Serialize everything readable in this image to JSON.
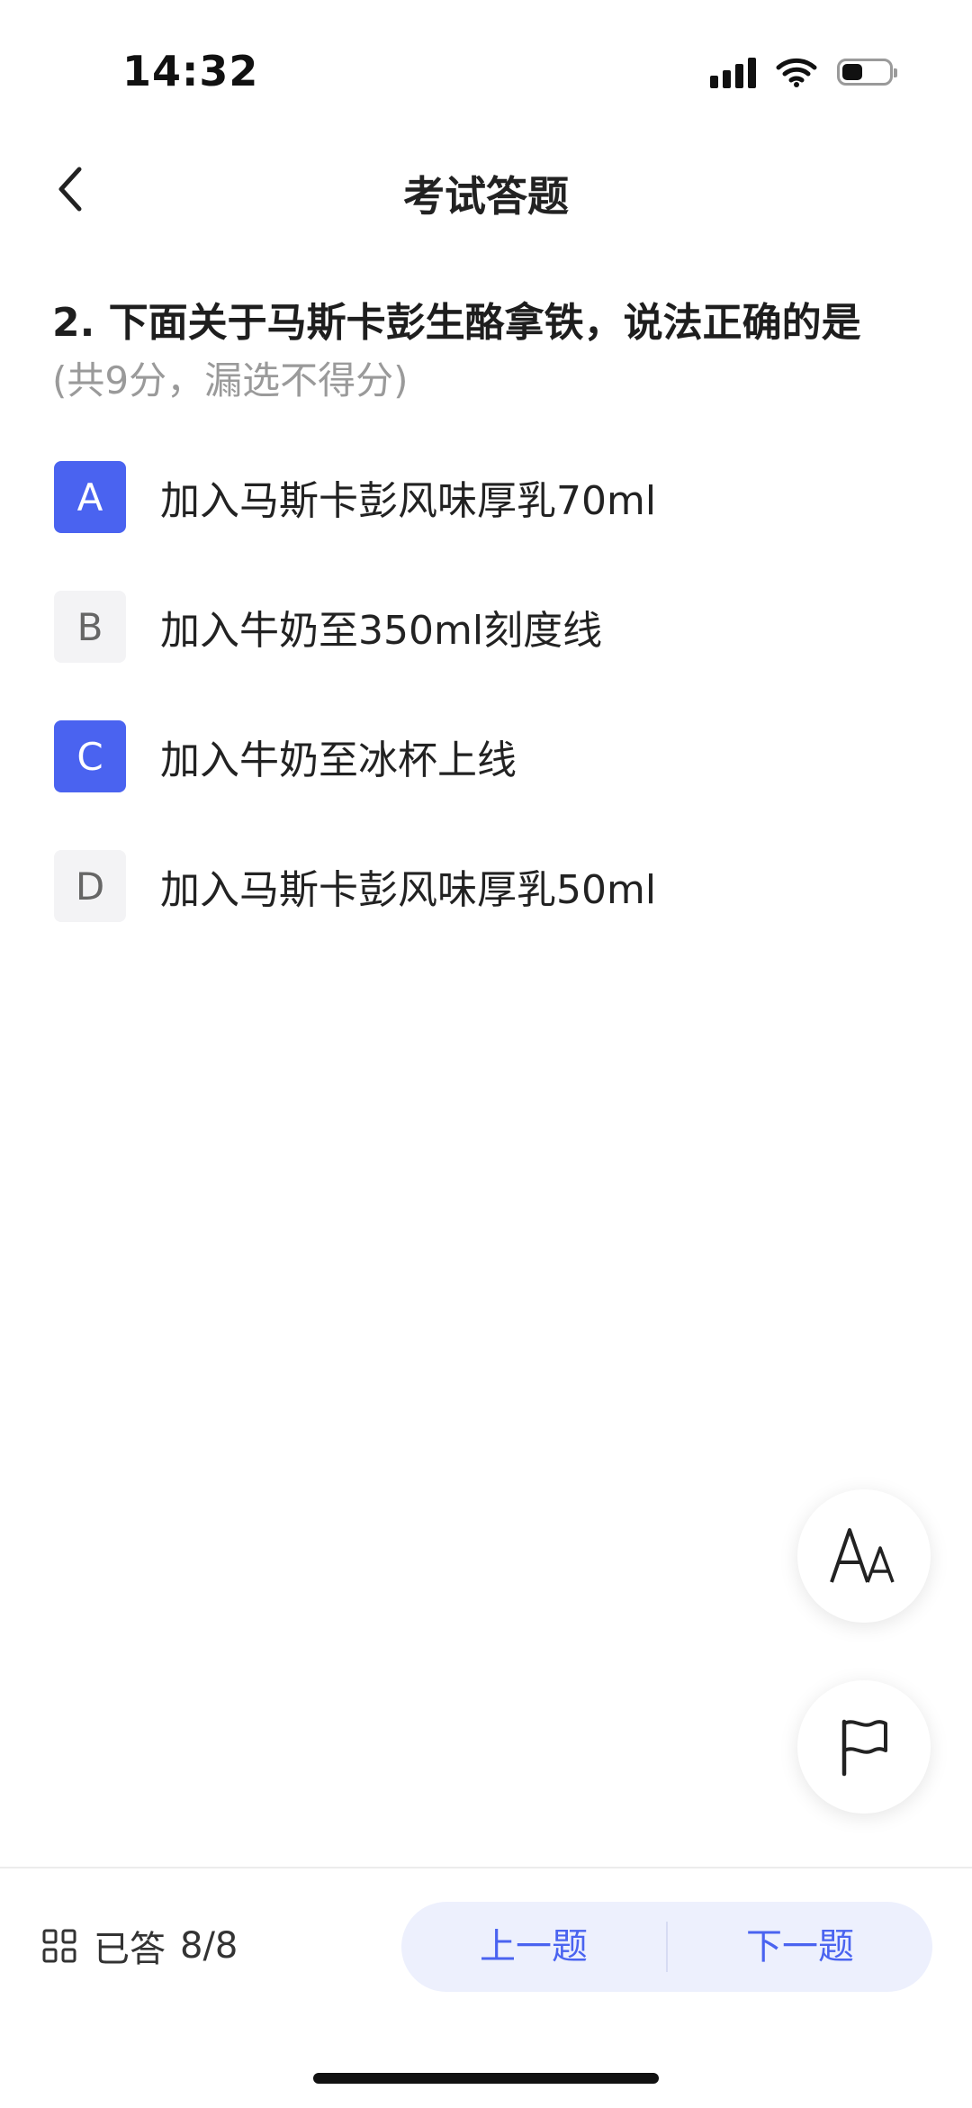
{
  "status_bar": {
    "time": "14:32",
    "icons": [
      "signal-icon",
      "wifi-icon",
      "battery-icon"
    ]
  },
  "nav": {
    "title": "考试答题",
    "back_icon": "chevron-left-icon"
  },
  "question": {
    "title": "2. 下面关于马斯卡彭生酪拿铁，说法正确的是",
    "score_note": "(共9分，漏选不得分)"
  },
  "options": [
    {
      "letter": "A",
      "text": "加入马斯卡彭风味厚乳70ml",
      "selected": true
    },
    {
      "letter": "B",
      "text": "加入牛奶至350ml刻度线",
      "selected": false
    },
    {
      "letter": "C",
      "text": "加入牛奶至冰杯上线",
      "selected": true
    },
    {
      "letter": "D",
      "text": "加入马斯卡彭风味厚乳50ml",
      "selected": false
    }
  ],
  "floating": {
    "font_size_icon": "font-size-icon",
    "flag_icon": "flag-icon"
  },
  "footer": {
    "grid_icon": "grid-icon",
    "answered_label": "已答",
    "answered_count": "8/8",
    "prev_label": "上一题",
    "next_label": "下一题"
  },
  "colors": {
    "accent": "#4a63f0",
    "option_bg": "#f3f3f5",
    "nav_button_bg": "#edf0fd",
    "muted_text": "#9a9a9a"
  }
}
